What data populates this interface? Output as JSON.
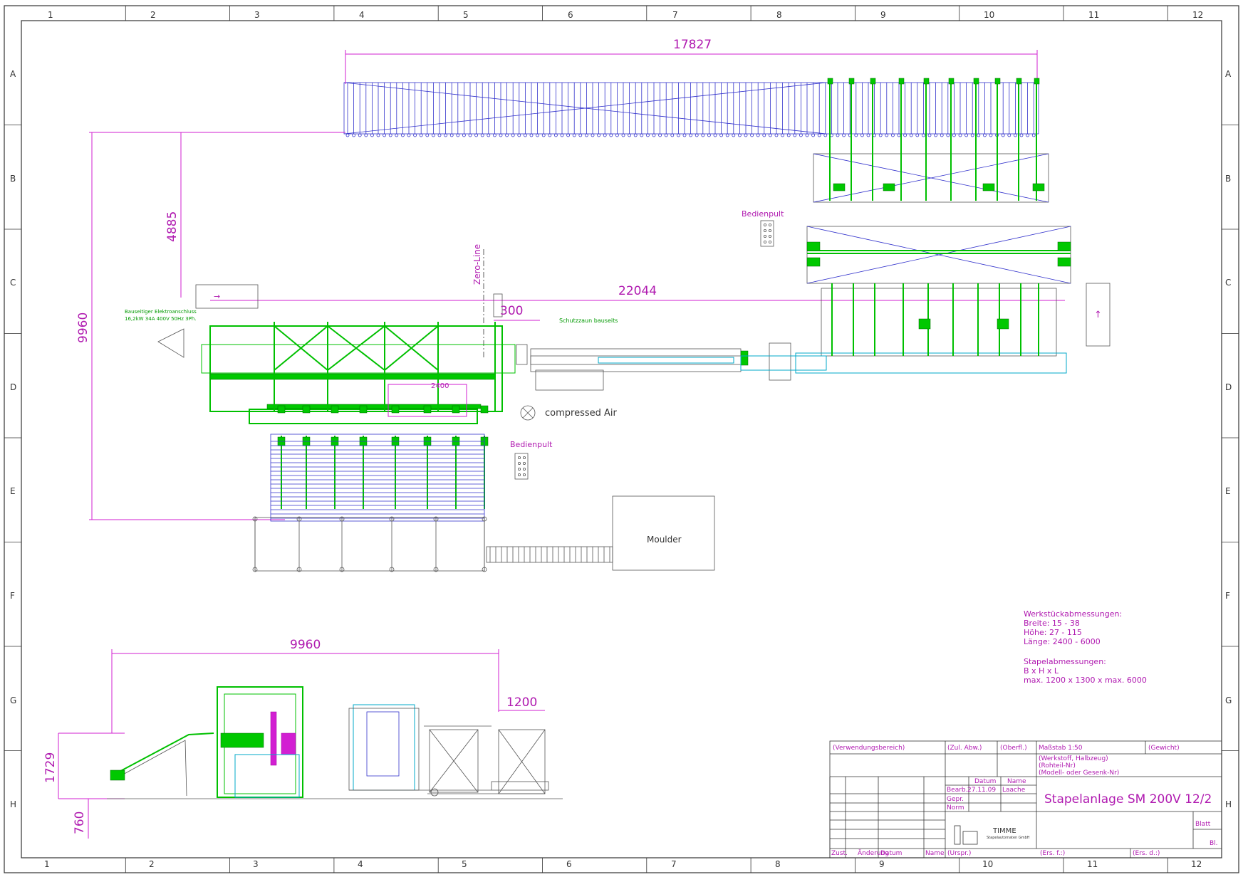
{
  "grid": {
    "columns": [
      "1",
      "2",
      "3",
      "4",
      "5",
      "6",
      "7",
      "8",
      "9",
      "10",
      "11",
      "12"
    ],
    "rows": [
      "A",
      "B",
      "C",
      "D",
      "E",
      "F",
      "G",
      "H"
    ]
  },
  "dimensions": {
    "top_length": "17827",
    "left_height": "9960",
    "upper_offset": "4885",
    "center_length": "22044",
    "zero_offset": "300",
    "inner_2400": "2400",
    "side_length": "9960",
    "side_1200": "1200",
    "side_height": "1729",
    "side_base": "760"
  },
  "labels": {
    "zero_line": "Zero-Line",
    "bedienpult_upper": "Bedienpult",
    "bedienpult_lower": "Bedienpult",
    "compressed_air": "compressed Air",
    "moulder": "Moulder",
    "motor_note_1": "Bauseitiger Elektroanschluss",
    "motor_note_2": "16,2kW 34A 400V 50Hz 3Ph.",
    "green_note": "Schutzzaun bauseits"
  },
  "specs": {
    "workpiece_title": "Werkstückabmessungen:",
    "breite": "Breite:  15 - 38",
    "hoehe": "Höhe:    27 - 115",
    "laenge": "Länge:   2400 - 6000",
    "stack_title": "Stapelabmessungen:",
    "stack_formula": "B x H x L",
    "stack_max": "max. 1200 x 1300 x max. 6000"
  },
  "title_block": {
    "verwendung": "(Verwendungsbereich)",
    "zul_abw": "(Zul. Abw.)",
    "oberfl": "(Oberfl.)",
    "massstab": "Maßstab  1:50",
    "gewicht": "(Gewicht)",
    "werkstoff_1": "(Werkstoff, Halbzeug)",
    "werkstoff_2": "(Rohteil-Nr)",
    "werkstoff_3": "(Modell- oder Gesenk-Nr)",
    "datum_header": "Datum",
    "name_header": "Name",
    "bearb": "Bearb.",
    "bearb_date": "27.11.09",
    "bearb_name": "Laache",
    "gepr": "Gepr.",
    "norm": "Norm",
    "drawing_title": "Stapelanlage SM 200V 12/2",
    "company": "TIMME",
    "company_sub": "Stapelautomaten GmbH",
    "blatt": "Blatt",
    "bl": "Bl.",
    "zust": "Zust.",
    "aenderung": "Änderung",
    "datum": "Datum",
    "name": "Name",
    "urspr": "(Urspr.)",
    "ers_f": "(Ers. f.:)",
    "ers_d": "(Ers. d.:)"
  },
  "colors": {
    "dimension": "#d21fd2",
    "machine_green": "#00c000",
    "conveyor_blue": "#3333cc",
    "frame": "#333333"
  }
}
